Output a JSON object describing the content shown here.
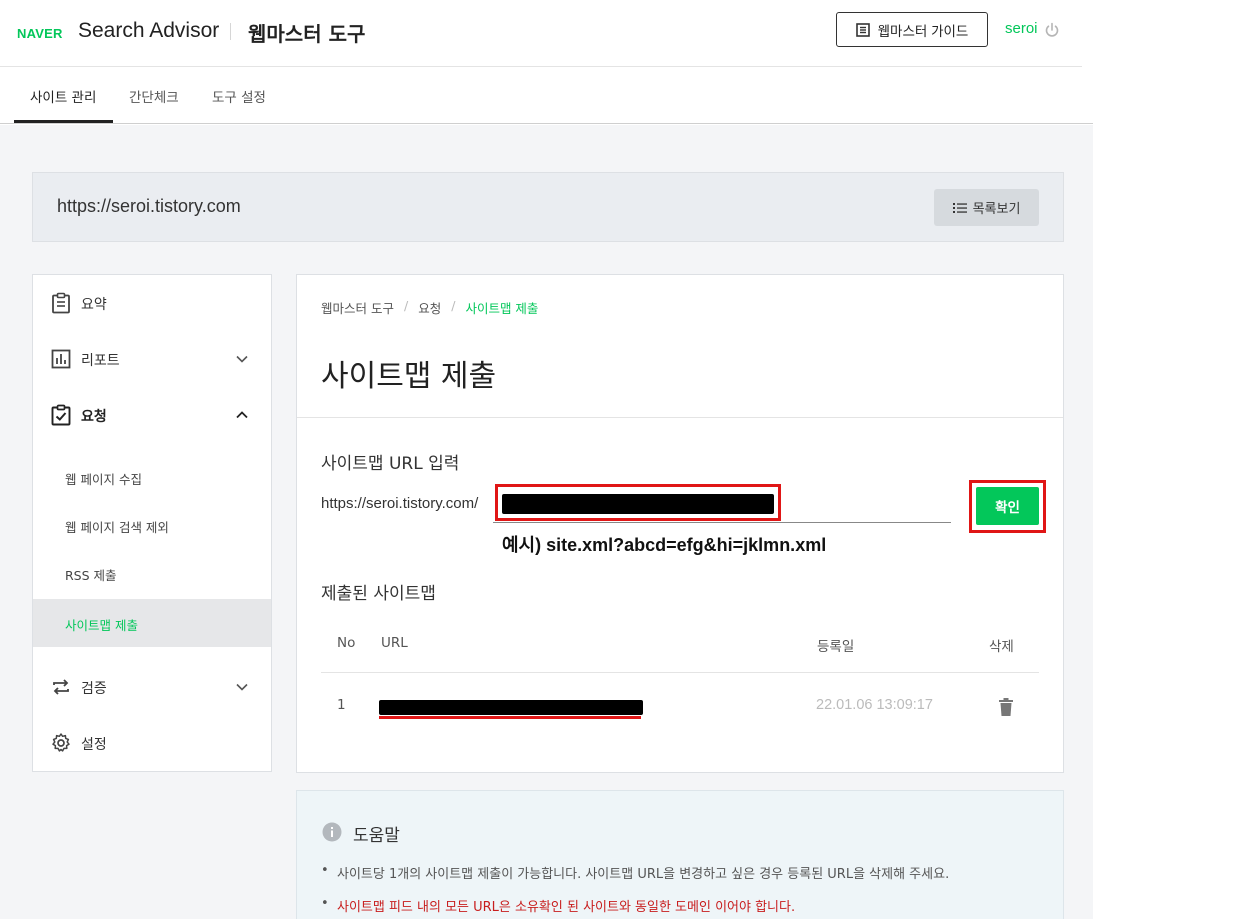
{
  "header": {
    "logo": "NAVER",
    "brand": "Search Advisor",
    "tool_name": "웹마스터 도구",
    "guide_button": "웹마스터 가이드",
    "user": "seroi"
  },
  "tabs": [
    {
      "label": "사이트 관리",
      "active": true
    },
    {
      "label": "간단체크",
      "active": false
    },
    {
      "label": "도구 설정",
      "active": false
    }
  ],
  "site": {
    "url": "https://seroi.tistory.com",
    "list_button": "목록보기"
  },
  "menu": {
    "items": [
      {
        "label": "요약",
        "icon": "clipboard-icon"
      },
      {
        "label": "리포트",
        "icon": "chart-icon"
      },
      {
        "label": "요청",
        "icon": "check-clipboard-icon"
      },
      {
        "label": "검증",
        "icon": "repeat-icon"
      },
      {
        "label": "설정",
        "icon": "gear-icon"
      }
    ],
    "sub_items": [
      {
        "label": "웹 페이지 수집",
        "active": false
      },
      {
        "label": "웹 페이지 검색 제외",
        "active": false
      },
      {
        "label": "RSS 제출",
        "active": false
      },
      {
        "label": "사이트맵 제출",
        "active": true
      }
    ]
  },
  "main": {
    "breadcrumb": [
      "웹마스터 도구",
      "요청",
      "사이트맵 제출"
    ],
    "title": "사이트맵 제출",
    "input_label": "사이트맵 URL 입력",
    "url_prefix": "https://seroi.tistory.com/",
    "confirm_button": "확인",
    "hint": "예시) site.xml?abcd=efg&hi=jklmn.xml",
    "submitted_title": "제출된 사이트맵",
    "table": {
      "headers": [
        "No",
        "URL",
        "등록일",
        "삭제"
      ],
      "rows": [
        {
          "no": "1",
          "url": "",
          "date": "22.01.06 13:09:17"
        }
      ]
    }
  },
  "help": {
    "title": "도움말",
    "items": [
      {
        "text": "사이트당 1개의 사이트맵 제출이 가능합니다. 사이트맵 URL을 변경하고 싶은 경우 등록된 URL을 삭제해 주세요.",
        "highlight": false
      },
      {
        "text": "사이트맵 피드 내의 모든 URL은 소유확인 된 사이트와 동일한 도메인 이어야 합니다.",
        "highlight": true
      }
    ]
  },
  "colors": {
    "brand_green": "#03c75a",
    "annotation_red": "#e01616",
    "warning_red": "#c81e1e",
    "gray_bg": "#f4f5f7"
  }
}
